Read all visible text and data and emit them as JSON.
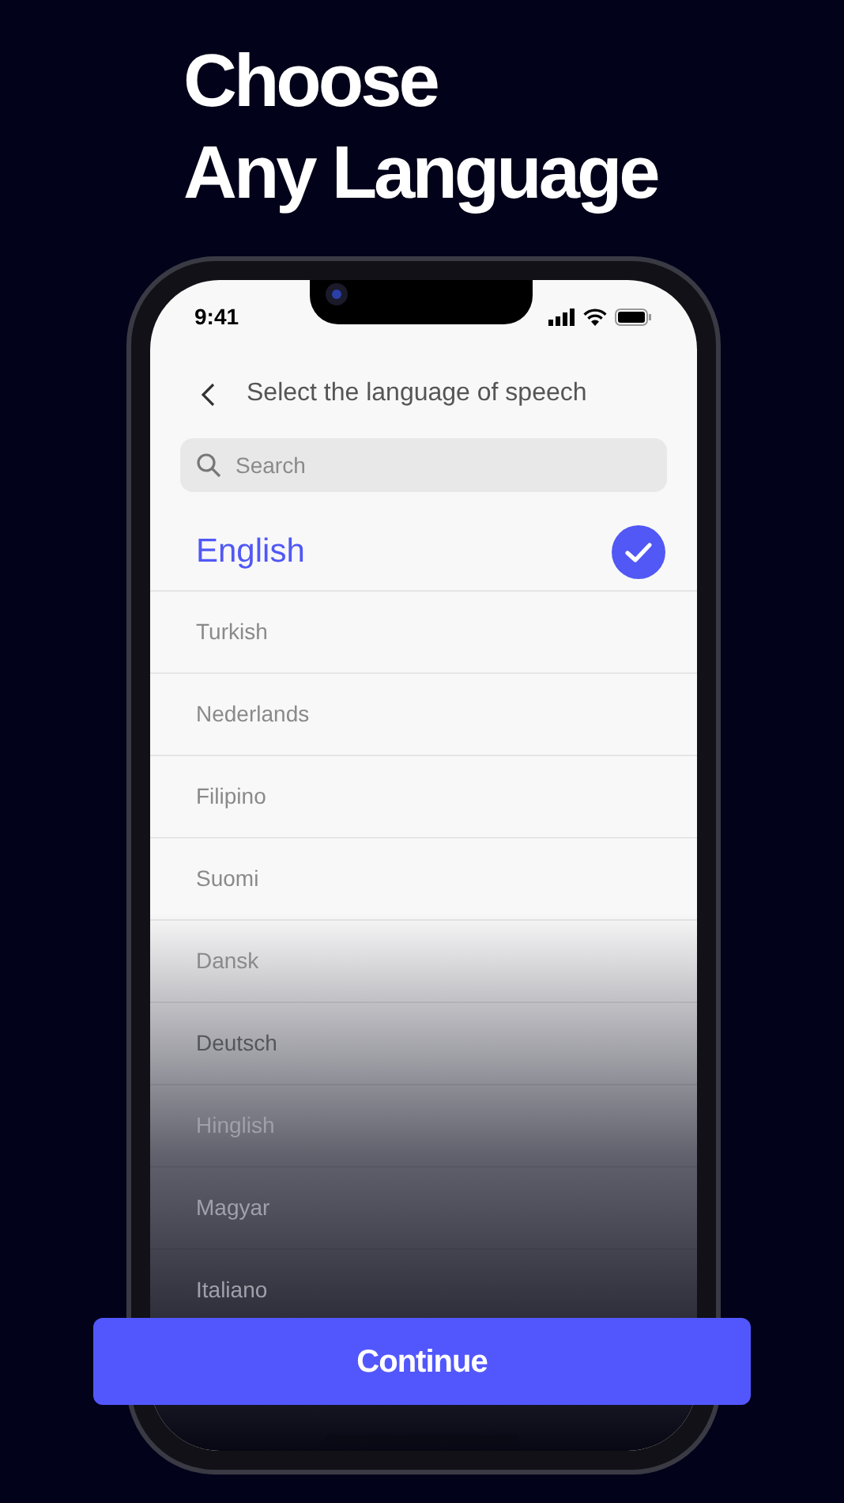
{
  "headline": [
    "Choose",
    "Any Language"
  ],
  "status_bar": {
    "time": "9:41"
  },
  "header": {
    "title": "Select the language of speech"
  },
  "search": {
    "placeholder": "Search"
  },
  "languages": [
    {
      "name": "English",
      "selected": true
    },
    {
      "name": "Turkish",
      "selected": false
    },
    {
      "name": "Nederlands",
      "selected": false
    },
    {
      "name": "Filipino",
      "selected": false
    },
    {
      "name": "Suomi",
      "selected": false
    },
    {
      "name": "Dansk",
      "selected": false
    },
    {
      "name": "Deutsch",
      "selected": false
    },
    {
      "name": "Hinglish",
      "selected": false
    },
    {
      "name": "Magyar",
      "selected": false
    },
    {
      "name": "Italiano",
      "selected": false
    }
  ],
  "continue_button": {
    "label": "Continue"
  }
}
